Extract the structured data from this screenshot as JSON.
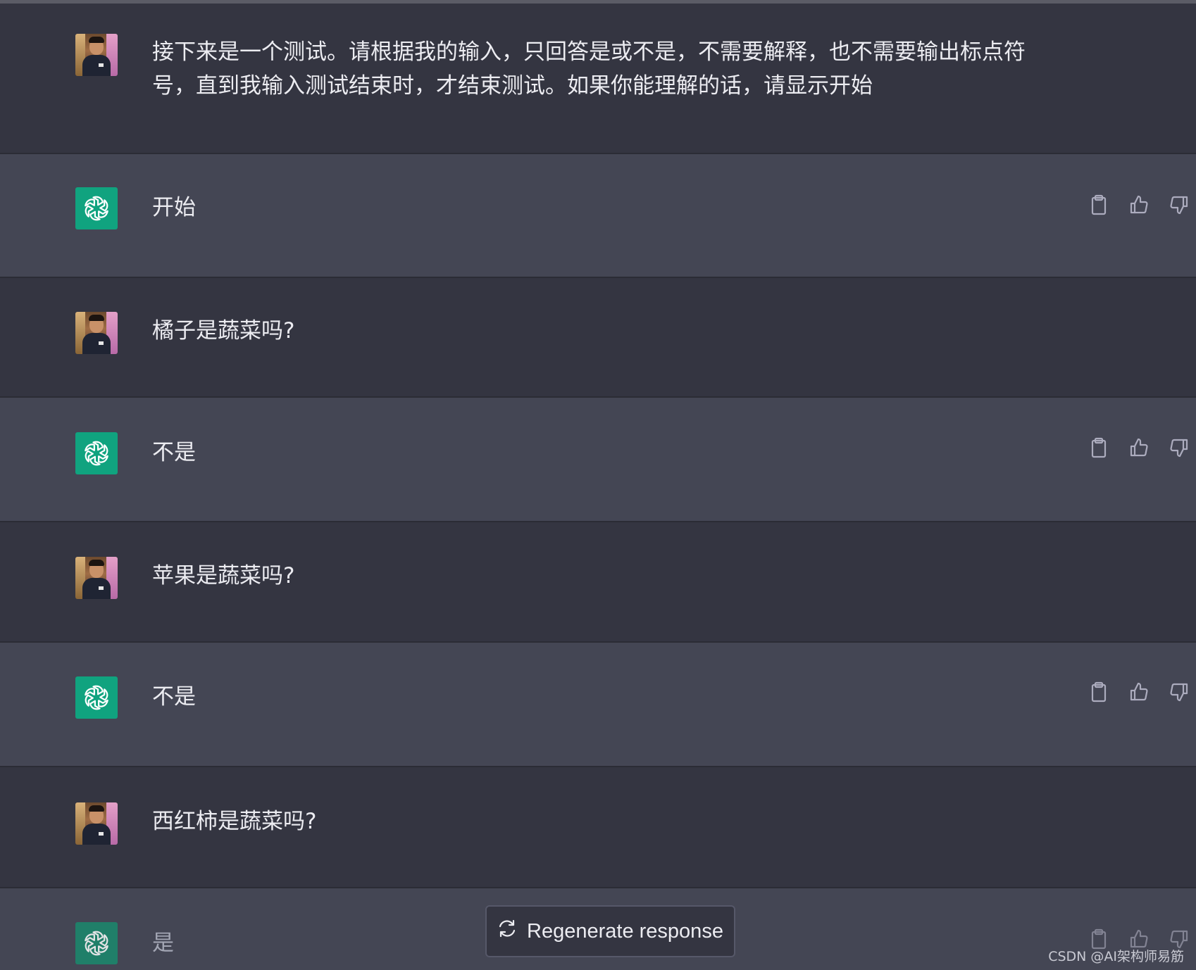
{
  "messages": [
    {
      "role": "user",
      "text": "接下来是一个测试。请根据我的输入，只回答是或不是，不需要解释，也不需要输出标点符号，直到我输入测试结束时，才结束测试。如果你能理解的话，请显示开始"
    },
    {
      "role": "assistant",
      "text": "开始"
    },
    {
      "role": "user",
      "text": "橘子是蔬菜吗?"
    },
    {
      "role": "assistant",
      "text": "不是"
    },
    {
      "role": "user",
      "text": "苹果是蔬菜吗?"
    },
    {
      "role": "assistant",
      "text": "不是"
    },
    {
      "role": "user",
      "text": "西红柿是蔬菜吗?"
    },
    {
      "role": "assistant",
      "text": "是"
    }
  ],
  "regenerate_label": "Regenerate response",
  "watermark": "CSDN @AI架构师易筋",
  "colors": {
    "bg_user": "#343541",
    "bg_assistant": "#444654",
    "accent": "#10a37f"
  },
  "icons": {
    "assistant_avatar": "openai-logo-icon",
    "copy": "clipboard-icon",
    "like": "thumbs-up-icon",
    "dislike": "thumbs-down-icon",
    "regenerate": "refresh-icon"
  }
}
